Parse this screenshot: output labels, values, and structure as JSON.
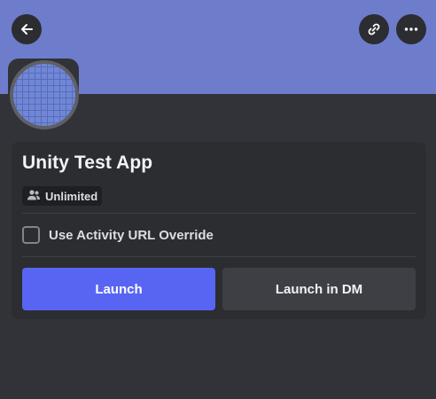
{
  "header": {
    "back_icon": "arrow-left-icon",
    "link_icon": "link-icon",
    "more_icon": "more-horizontal-icon",
    "banner_color": "#6e7ccc"
  },
  "app": {
    "name": "Unity Test App",
    "badge_icon": "people-icon",
    "badge_label": "Unlimited"
  },
  "override": {
    "label": "Use Activity URL Override",
    "checked": false
  },
  "actions": {
    "launch_label": "Launch",
    "launch_dm_label": "Launch in DM",
    "primary_color": "#5865f2"
  }
}
